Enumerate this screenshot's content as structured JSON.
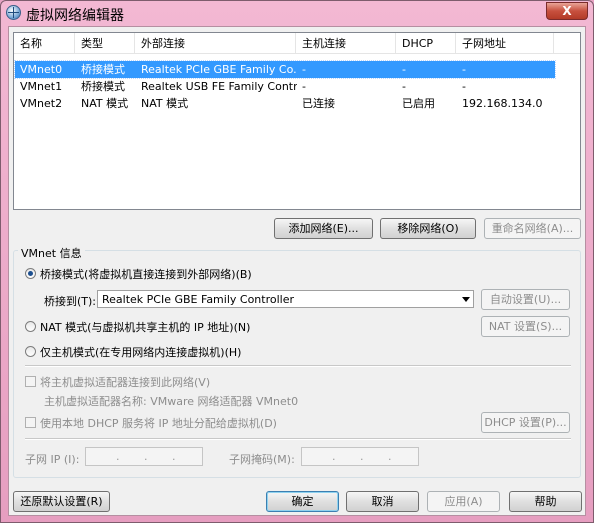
{
  "window": {
    "title": "虚拟网络编辑器",
    "close_label": "X"
  },
  "table": {
    "columns": [
      "名称",
      "类型",
      "外部连接",
      "主机连接",
      "DHCP",
      "子网地址"
    ],
    "rows": [
      {
        "name": "VMnet0",
        "type": "桥接模式",
        "external": "Realtek PCIe GBE Family Co...",
        "host": "-",
        "dhcp": "-",
        "subnet": "-",
        "selected": true
      },
      {
        "name": "VMnet1",
        "type": "桥接模式",
        "external": "Realtek USB FE Family Contr...",
        "host": "-",
        "dhcp": "-",
        "subnet": "-",
        "selected": false
      },
      {
        "name": "VMnet2",
        "type": "NAT 模式",
        "external": "NAT 模式",
        "host": "已连接",
        "dhcp": "已启用",
        "subnet": "192.168.134.0",
        "selected": false
      }
    ]
  },
  "buttons": {
    "add_network": "添加网络(E)...",
    "remove_network": "移除网络(O)",
    "rename_network": "重命名网络(A)...",
    "auto_settings": "自动设置(U)...",
    "nat_settings": "NAT 设置(S)...",
    "dhcp_settings": "DHCP 设置(P)...",
    "restore_defaults": "还原默认设置(R)",
    "ok": "确定",
    "cancel": "取消",
    "apply": "应用(A)",
    "help": "帮助"
  },
  "vmnet_info": {
    "group_title": "VMnet 信息",
    "bridged_radio": "桥接模式(将虚拟机直接连接到外部网络)(B)",
    "bridged_to_label": "桥接到(T):",
    "bridged_to_value": "Realtek PCIe GBE Family Controller",
    "nat_radio": "NAT 模式(与虚拟机共享主机的 IP 地址)(N)",
    "host_only_radio": "仅主机模式(在专用网络内连接虚拟机)(H)",
    "selected_mode": "bridged",
    "connect_host_adapter": "将主机虚拟适配器连接到此网络(V)",
    "host_adapter_name": "主机虚拟适配器名称: VMware 网络适配器 VMnet0",
    "use_local_dhcp": "使用本地 DHCP 服务将 IP 地址分配给虚拟机(D)",
    "subnet_ip_label": "子网 IP (I):",
    "subnet_mask_label": "子网掩码(M):",
    "ip_dot": "."
  }
}
